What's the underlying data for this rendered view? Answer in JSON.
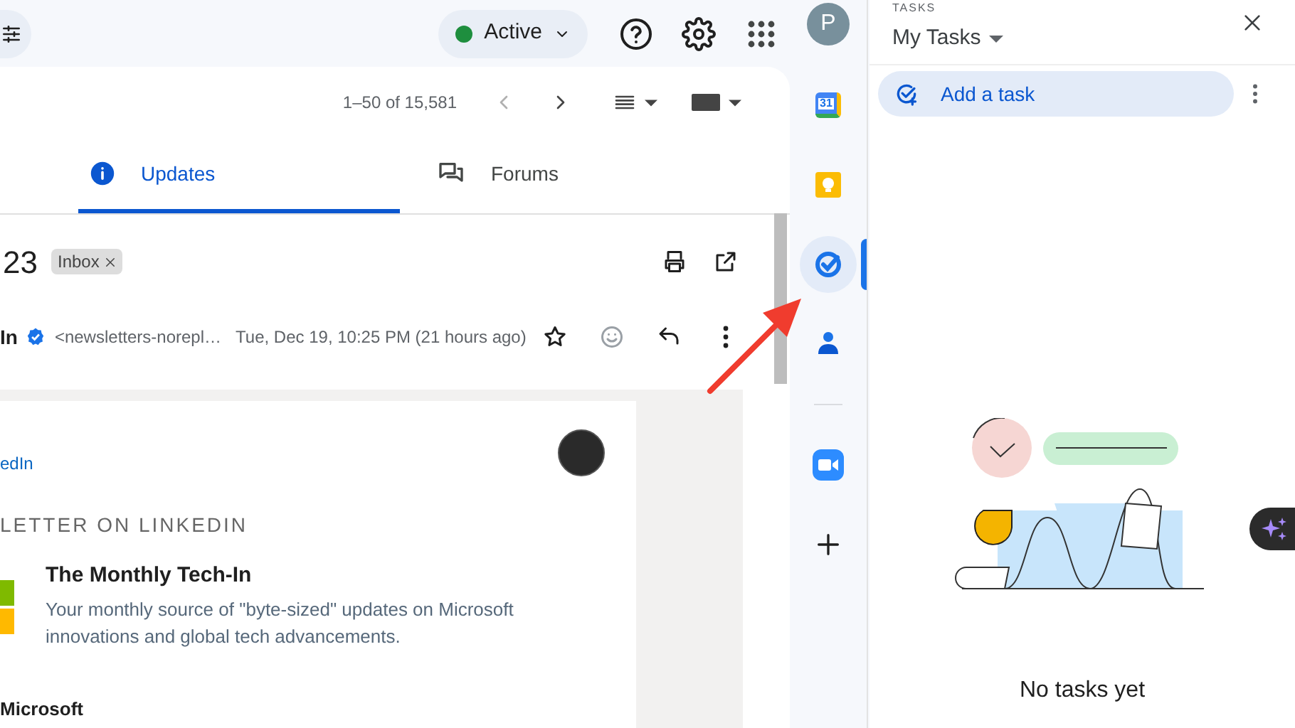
{
  "top_bar": {
    "status": "Active",
    "avatar": "P"
  },
  "toolbar": {
    "pagination": "1–50 of 15,581"
  },
  "tabs": [
    {
      "label": "Updates",
      "selected": true,
      "kind": "info"
    },
    {
      "label": "Forums",
      "selected": false,
      "kind": "forum"
    }
  ],
  "message": {
    "subject": "23",
    "label": "Inbox",
    "sender": "In",
    "address": "<newsletters-norepl…",
    "date": "Tue, Dec 19, 10:25 PM (21 hours ago)",
    "starred": false
  },
  "body": {
    "link": "edIn",
    "kicker": "LETTER ON LINKEDIN",
    "title": "The Monthly Tech-In",
    "description": "Your monthly source of \"byte-sized\" updates on Microsoft innovations and global tech advancements.",
    "footer": "Microsoft"
  },
  "side_apps": [
    {
      "kind": "calendar",
      "selected": false,
      "badge": "31"
    },
    {
      "kind": "keep",
      "selected": false
    },
    {
      "kind": "tasks",
      "selected": true
    },
    {
      "kind": "contacts",
      "selected": false
    }
  ],
  "side_addons": [
    {
      "kind": "zoom"
    },
    {
      "kind": "add"
    }
  ],
  "tasks_panel": {
    "heading": "TASKS",
    "list": "My Tasks",
    "add": "Add a task",
    "empty": "No tasks yet"
  }
}
